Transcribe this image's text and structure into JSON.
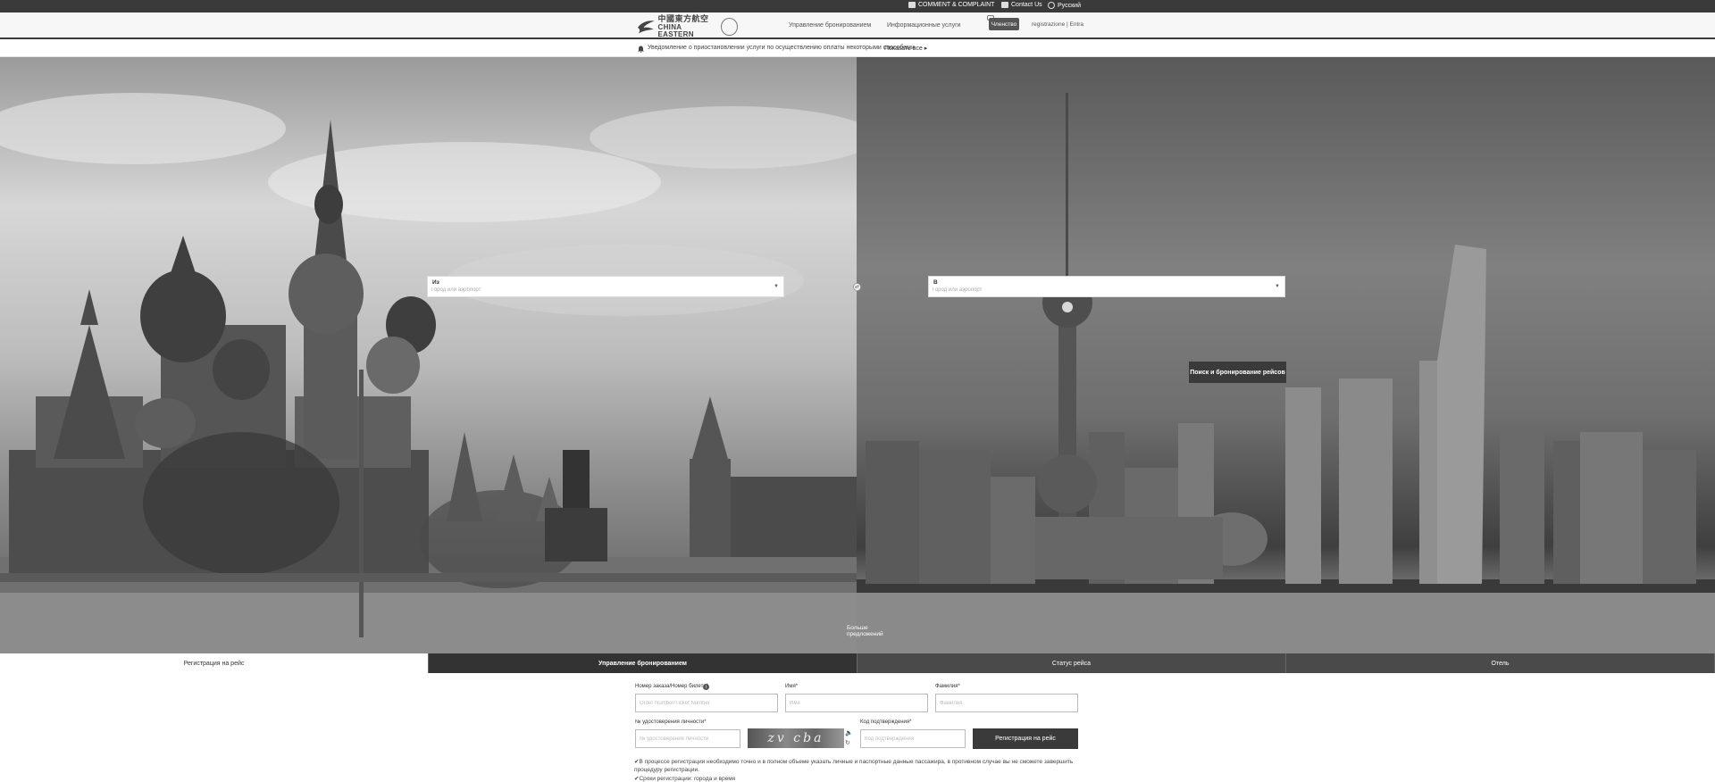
{
  "topbar": {
    "comment": "COMMENT & COMPLAINT",
    "contact": "Contact Us",
    "language": "Русский"
  },
  "header": {
    "logo_cn": "中國東方航空",
    "logo_en": "CHINA EASTERN",
    "nav": [
      {
        "label": "Управление бронированием"
      },
      {
        "label": "Информационные услуги"
      }
    ],
    "member": "Членство",
    "login": "registrazione | Entra"
  },
  "notice": {
    "text": "Уведомление о приостановлении услуги по осуществлению оплаты некоторыми способами",
    "more": "Показать все"
  },
  "search": {
    "from_label": "Из",
    "from_placeholder": "Город или аэропорт",
    "to_label": "В",
    "to_placeholder": "Город или аэропорт",
    "button": "Поиск и бронирование рейсов",
    "more_offers": "Больше предложений"
  },
  "tabs": [
    {
      "label": "Регистрация на рейс"
    },
    {
      "label": "Управление бронированием"
    },
    {
      "label": "Статус рейса"
    },
    {
      "label": "Отель"
    }
  ],
  "form": {
    "order_label": "Номер заказа/Номер билета",
    "order_placeholder": "Order Number/Ticket Number",
    "first_name_label": "Имя",
    "first_name_placeholder": "Имя",
    "last_name_label": "Фамилия",
    "last_name_placeholder": "Фамилия",
    "id_label": "№ удостоверения личности",
    "id_placeholder": "№ удостоверения личности",
    "captcha_text": "zv cba",
    "code_label": "Код подтверждения",
    "code_placeholder": "Код подтверждения",
    "submit": "Регистрация на рейс",
    "note1": "В процессе регистрации необходимо точно и в полном объеме указать личные и паспортные данные пассажира, в противном случае вы не сможете завершить процедуру регистрации.",
    "note2": "Сроки регистрации: города и время"
  }
}
